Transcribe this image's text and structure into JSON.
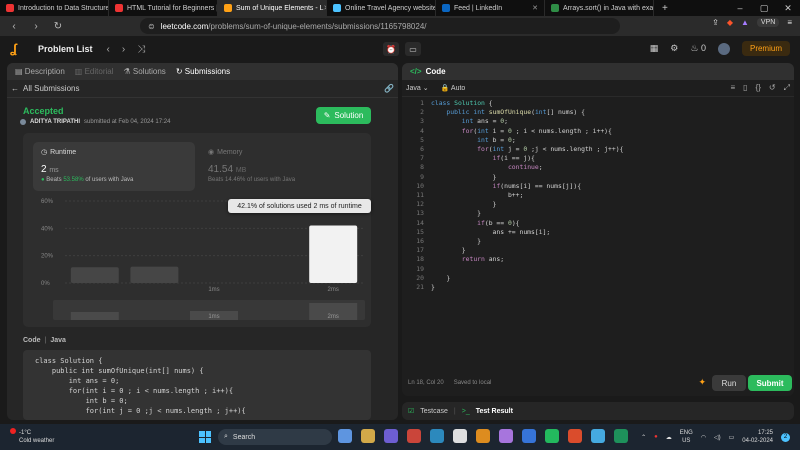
{
  "browser": {
    "tabs": [
      {
        "title": "Introduction to Data Structures a",
        "color": "#e33"
      },
      {
        "title": "HTML Tutorial for Beginners | Co",
        "color": "#e33"
      },
      {
        "title": "Sum of Unique Elements - L",
        "color": "#ffa116",
        "active": true
      },
      {
        "title": "Online Travel Agency website | F",
        "color": "#4cc2ff"
      },
      {
        "title": "Feed | LinkedIn",
        "color": "#0a66c2"
      },
      {
        "title": "Arrays.sort() in Java with examp",
        "color": "#2f8d46"
      }
    ],
    "url_host": "leetcode.com",
    "url_path": "/problems/sum-of-unique-elements/submissions/1165798024/",
    "vpn_label": "VPN"
  },
  "header": {
    "problem_list": "Problem List",
    "streak": "0",
    "premium": "Premium"
  },
  "left": {
    "tabs": {
      "description": "Description",
      "editorial": "Editorial",
      "solutions": "Solutions",
      "submissions": "Submissions"
    },
    "all_submissions": "All Submissions",
    "status": "Accepted",
    "author": "ADITYA TRIPATHI",
    "submitted_at": "submitted at Feb 04, 2024 17:24",
    "solution_button": "Solution",
    "runtime": {
      "label": "Runtime",
      "value": "2",
      "unit": "ms",
      "beats_prefix": "Beats",
      "beats_pct": "53.58%",
      "beats_suffix": "of users with Java"
    },
    "memory": {
      "label": "Memory",
      "value": "41.54",
      "unit": "MB",
      "beats_text": "Beats 14.46% of users with Java"
    },
    "tooltip": "42.1% of solutions used 2 ms of runtime",
    "code_label": "Code",
    "code_lang": "Java",
    "code_preview": "class Solution {\n    public int sumOfUnique(int[] nums) {\n        int ans = 0;\n        for(int i = 0 ; i < nums.length ; i++){\n            int b = 0;\n            for(int j = 0 ;j < nums.length ; j++){"
  },
  "chart_data": {
    "type": "bar",
    "categories": [
      "",
      "",
      "1ms",
      "",
      "2ms"
    ],
    "values": [
      11.5,
      12,
      0,
      0,
      42.1
    ],
    "highlight_index": 4,
    "yticks": [
      "0%",
      "20%",
      "40%",
      "60%"
    ],
    "ylim": [
      0,
      60
    ]
  },
  "right": {
    "title": "Code",
    "language": "Java",
    "mode": "Auto",
    "line_numbers": "1\n2\n3\n4\n5\n6\n7\n8\n9\n10\n11\n12\n13\n14\n15\n16\n17\n18\n19\n20\n21",
    "cursor": "Ln 18, Col 20",
    "saved": "Saved to local",
    "run": "Run",
    "submit": "Submit"
  },
  "testpanel": {
    "testcase": "Testcase",
    "result": "Test Result"
  },
  "taskbar": {
    "temp": "-1°C",
    "weather": "Cold weather",
    "search": "Search",
    "lang": "ENG",
    "region": "US",
    "time": "17:25",
    "date": "04-02-2024"
  }
}
